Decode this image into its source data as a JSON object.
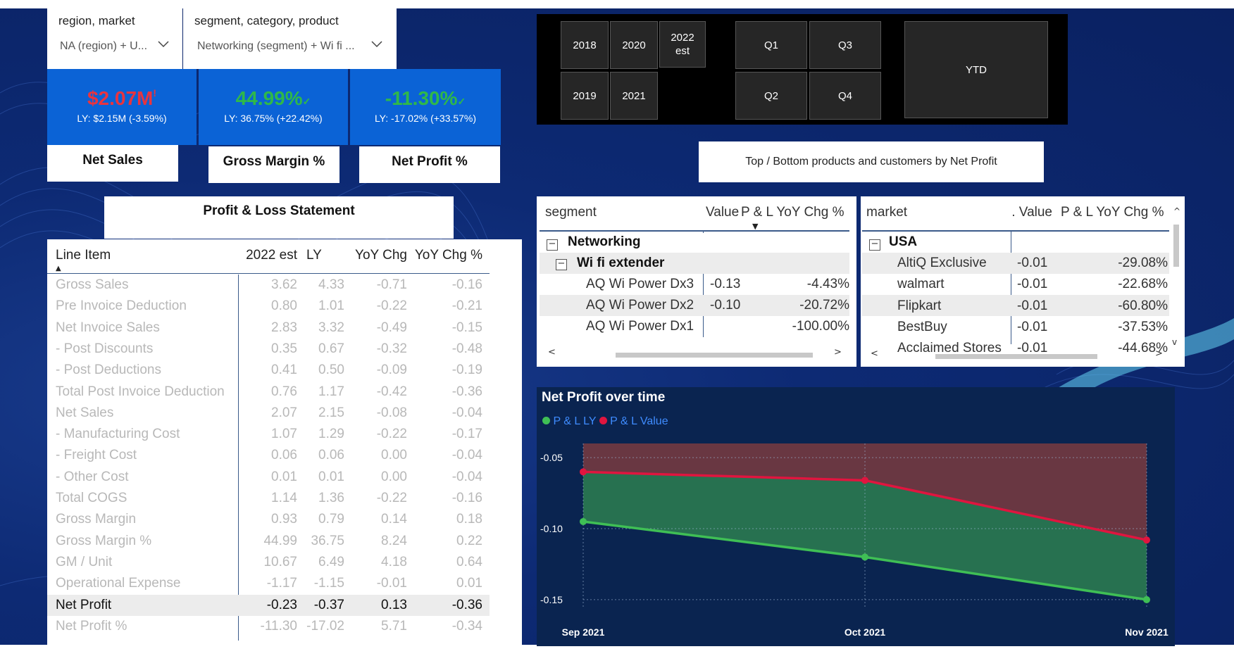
{
  "slicers": {
    "region": {
      "title": "region, market",
      "value": "NA (region) + U..."
    },
    "segment": {
      "title": "segment, category, product",
      "value": "Networking (segment) + Wi fi ..."
    }
  },
  "kpis": [
    {
      "value": "$2.07M",
      "flag": "!",
      "ly": "LY: $2.15M (-3.59%)",
      "label": "Net Sales",
      "color": "#e8343f"
    },
    {
      "value": "44.99%",
      "flag": "✓",
      "ly": "LY: 36.75% (+22.42%)",
      "label": "Gross Margin %",
      "color": "#2fb84a"
    },
    {
      "value": "-11.30%",
      "flag": "✓",
      "ly": "LY: -17.02% (+33.57%)",
      "label": "Net Profit %",
      "color": "#2fb84a"
    }
  ],
  "year_buttons": [
    "2018",
    "2020",
    "2022 est",
    "2019",
    "2021"
  ],
  "quarter_buttons": [
    "Q1",
    "Q3",
    "Q2",
    "Q4"
  ],
  "ytd_button": "YTD",
  "top_bottom_button": "Top / Bottom products and customers by Net Profit",
  "pl": {
    "title": "Profit & Loss Statement",
    "columns": [
      "Line Item",
      "2022 est",
      "LY",
      "YoY Chg",
      "YoY Chg %"
    ],
    "rows": [
      [
        "Gross Sales",
        "3.62",
        "4.33",
        "-0.71",
        "-0.16"
      ],
      [
        "Pre Invoice Deduction",
        "0.80",
        "1.01",
        "-0.22",
        "-0.21"
      ],
      [
        "Net Invoice Sales",
        "2.83",
        "3.32",
        "-0.49",
        "-0.15"
      ],
      [
        "- Post Discounts",
        "0.35",
        "0.67",
        "-0.32",
        "-0.48"
      ],
      [
        "- Post Deductions",
        "0.41",
        "0.50",
        "-0.09",
        "-0.19"
      ],
      [
        "Total Post Invoice Deduction",
        "0.76",
        "1.17",
        "-0.42",
        "-0.36"
      ],
      [
        "Net Sales",
        "2.07",
        "2.15",
        "-0.08",
        "-0.04"
      ],
      [
        "- Manufacturing Cost",
        "1.07",
        "1.29",
        "-0.22",
        "-0.17"
      ],
      [
        "- Freight Cost",
        "0.06",
        "0.06",
        "0.00",
        "-0.04"
      ],
      [
        "- Other Cost",
        "0.01",
        "0.01",
        "0.00",
        "-0.04"
      ],
      [
        "Total COGS",
        "1.14",
        "1.36",
        "-0.22",
        "-0.16"
      ],
      [
        "Gross Margin",
        "0.93",
        "0.79",
        "0.14",
        "0.18"
      ],
      [
        "Gross Margin %",
        "44.99",
        "36.75",
        "8.24",
        "0.22"
      ],
      [
        "GM / Unit",
        "10.67",
        "6.49",
        "4.18",
        "0.64"
      ],
      [
        "Operational Expense",
        "-1.17",
        "-1.15",
        "-0.01",
        "0.01"
      ],
      [
        "Net Profit",
        "-0.23",
        "-0.37",
        "0.13",
        "-0.36"
      ],
      [
        "Net Profit %",
        "-11.30",
        "-17.02",
        "5.71",
        "-0.34"
      ]
    ],
    "highlight_row": "Net Profit"
  },
  "segment_matrix": {
    "columns": [
      "segment",
      "Value",
      "P & L YoY Chg %"
    ],
    "group": "Networking",
    "subgroup": "Wi fi extender",
    "rows": [
      [
        "AQ Wi Power Dx3",
        "-0.13",
        "-4.43%"
      ],
      [
        "AQ Wi Power Dx2",
        "-0.10",
        "-20.72%"
      ],
      [
        "AQ Wi Power Dx1",
        "",
        "-100.00%"
      ]
    ]
  },
  "market_matrix": {
    "columns": [
      "market",
      ". Value",
      "P & L YoY Chg %"
    ],
    "group": "USA",
    "rows": [
      [
        "AltiQ Exclusive",
        "-0.01",
        "-29.08%"
      ],
      [
        "walmart",
        "-0.01",
        "-22.68%"
      ],
      [
        "Flipkart",
        "-0.01",
        "-60.80%"
      ],
      [
        "BestBuy",
        "-0.01",
        "-37.53%"
      ],
      [
        "Acclaimed Stores",
        "-0.01",
        "-44.68%"
      ]
    ]
  },
  "chart_data": {
    "type": "line",
    "title": "Net Profit over time",
    "categories": [
      "Sep 2021",
      "Oct 2021",
      "Nov 2021"
    ],
    "series": [
      {
        "name": "P & L LY",
        "values": [
          -0.095,
          -0.12,
          -0.15
        ],
        "color": "#3fbf55"
      },
      {
        "name": "P & L Value",
        "values": [
          -0.06,
          -0.066,
          -0.108
        ],
        "color": "#e0153f"
      }
    ],
    "yticks": [
      "-0.05",
      "-0.10",
      "-0.15"
    ],
    "ylim": [
      -0.15,
      -0.04
    ],
    "legend": "top-left",
    "grid": true
  }
}
